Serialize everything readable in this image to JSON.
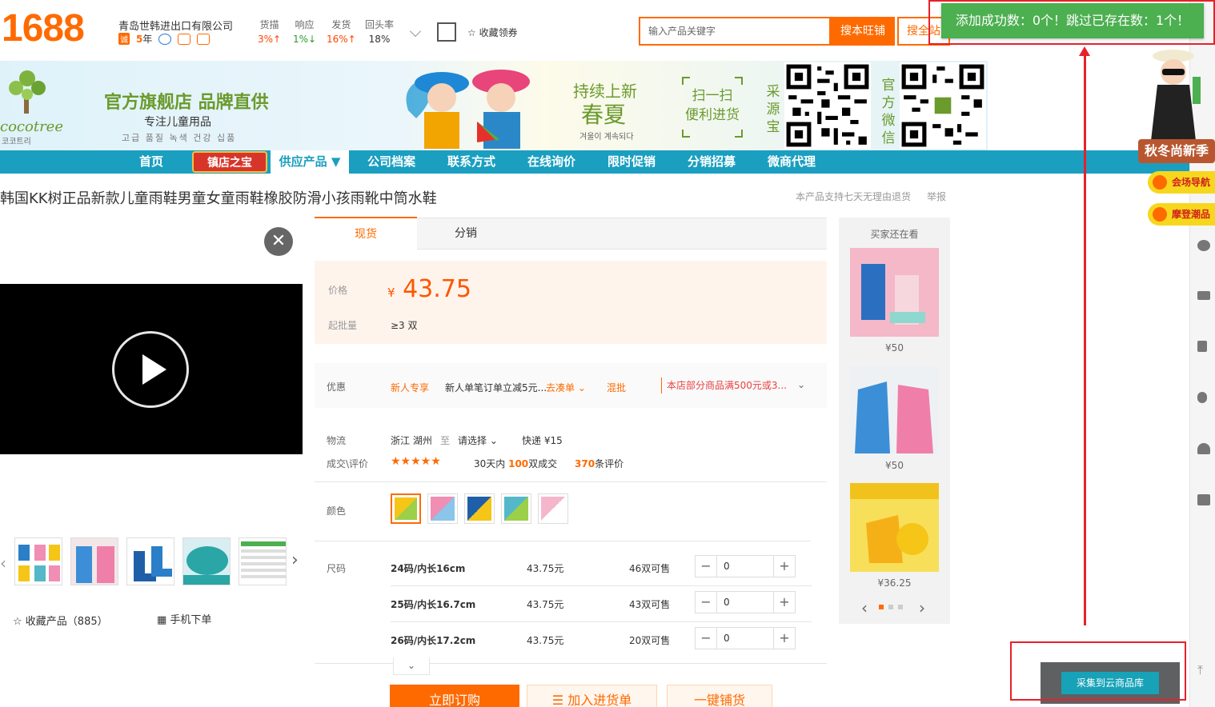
{
  "header": {
    "logo": "1688",
    "company": "青岛世韩进出口有限公司",
    "cheng": "诚",
    "years_num": "5",
    "years_unit": "年",
    "stats": [
      {
        "label": "货描",
        "value": "3%↑"
      },
      {
        "label": "响应",
        "value": "1%↓"
      },
      {
        "label": "发货",
        "value": "16%↑"
      },
      {
        "label": "回头率",
        "value": "18%"
      }
    ],
    "favorite": "收藏领券",
    "search_placeholder": "输入产品关键字",
    "search_shop": "搜本旺铺",
    "search_all": "搜全站"
  },
  "toast": "添加成功数：0个！跳过已存在数：1个！",
  "banner": {
    "brand": "cocotree",
    "brand_kr": "코코트리",
    "slogan": "官方旗舰店 品牌直供",
    "sub_slogan": "专注儿童用品",
    "sub_kr": "고급 품질 녹색 건강 십품",
    "season1": "持续上新",
    "season2": "春夏",
    "season3": "겨울이 계속되다",
    "scan1": "扫一扫",
    "scan2": "便利进货",
    "vert1": "采源宝",
    "vert2": "官方微信"
  },
  "nav": {
    "items": [
      "首页",
      "供应产品 ▼",
      "公司档案",
      "联系方式",
      "在线询价",
      "限时促销",
      "分销招募",
      "微商代理"
    ],
    "hot": "镇店之宝"
  },
  "product": {
    "title": "韩国KK树正品新款儿童雨鞋男童女童雨鞋橡胶防滑小孩雨靴中筒水鞋",
    "return_policy": "本产品支持七天无理由退货",
    "report": "举报",
    "collect": "收藏产品（885）",
    "mobile_order": "手机下单",
    "tabs": [
      "现货",
      "分销"
    ],
    "price_label": "价格",
    "yen": "¥",
    "price": "43.75",
    "moq_label": "起批量",
    "moq": "≥3 双",
    "promo_label": "优惠",
    "promo_new": "新人专享",
    "promo_text": "新人单笔订单立减5元...",
    "promo_link": "去凑单",
    "promo_mix": "混批",
    "promo_tag": "本店部分商品满500元或3...",
    "logistics_label": "物流",
    "from": "浙江 湖州",
    "to_word": "至",
    "to_select": "请选择",
    "express": "快递 ¥15",
    "review_label": "成交\\评价",
    "stars": "★★★★★",
    "sold_pre": "30天内",
    "sold_num": "100",
    "sold_post": "双成交",
    "review_num": "370",
    "review_post": "条评价",
    "color_label": "颜色",
    "size_label": "尺码",
    "sizes": [
      {
        "name": "24码/内长16cm",
        "price": "43.75元",
        "stock": "46双可售",
        "qty": "0"
      },
      {
        "name": "25码/内长16.7cm",
        "price": "43.75元",
        "stock": "43双可售",
        "qty": "0"
      },
      {
        "name": "26码/内长17.2cm",
        "price": "43.75元",
        "stock": "20双可售",
        "qty": "0"
      }
    ],
    "buy": "立即订购",
    "cart": "加入进货单",
    "distribute": "一键铺货"
  },
  "also_view": {
    "title": "买家还在看",
    "prices": [
      "¥50",
      "¥50",
      "¥36.25"
    ]
  },
  "sidebar": {
    "fashion": "秋冬尚新季",
    "nav_guide": "会场导航",
    "trendy": "摩登潮品"
  },
  "collect_cloud": "采集到云商品库"
}
